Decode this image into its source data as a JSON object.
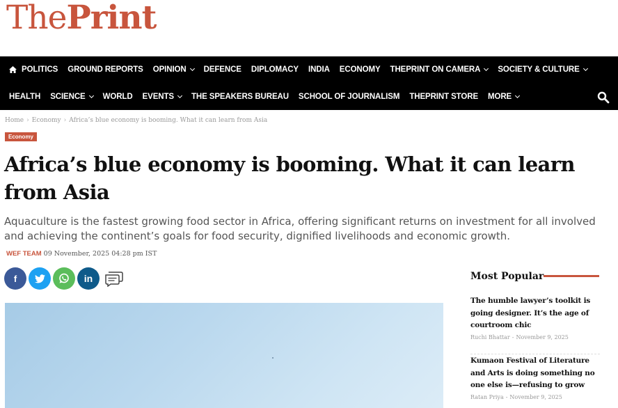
{
  "logo": {
    "the": "The",
    "print": "Print"
  },
  "nav": {
    "row1": [
      {
        "label": "POLITICS",
        "dropdown": false
      },
      {
        "label": "GROUND REPORTS",
        "dropdown": false
      },
      {
        "label": "OPINION",
        "dropdown": true
      },
      {
        "label": "DEFENCE",
        "dropdown": false
      },
      {
        "label": "DIPLOMACY",
        "dropdown": false
      },
      {
        "label": "INDIA",
        "dropdown": false
      },
      {
        "label": "ECONOMY",
        "dropdown": false
      },
      {
        "label": "THEPRINT ON CAMERA",
        "dropdown": true
      },
      {
        "label": "SOCIETY & CULTURE",
        "dropdown": true
      }
    ],
    "row2": [
      {
        "label": "HEALTH",
        "dropdown": false
      },
      {
        "label": "SCIENCE",
        "dropdown": true
      },
      {
        "label": "WORLD",
        "dropdown": false
      },
      {
        "label": "EVENTS",
        "dropdown": true
      },
      {
        "label": "THE SPEAKERS BUREAU",
        "dropdown": false
      },
      {
        "label": "SCHOOL OF JOURNALISM",
        "dropdown": false
      },
      {
        "label": "THEPRINT STORE",
        "dropdown": false
      },
      {
        "label": "MORE",
        "dropdown": true
      }
    ],
    "home_icon": "home-icon",
    "search_icon": "search-icon"
  },
  "breadcrumb": {
    "home": "Home",
    "section": "Economy",
    "current": "Africa’s blue economy is booming. What it can learn from Asia",
    "separator": "›"
  },
  "article": {
    "category": "Economy",
    "headline": "Africa’s blue economy is booming. What it can learn from Asia",
    "standfirst": "Aquaculture is the fastest growing food sector in Africa, offering significant returns on investment for all involved and achieving the continent’s goals for food security, dignified livelihoods and economic growth.",
    "author": "WEF TEAM",
    "date": "09 November, 2025 04:28 pm IST"
  },
  "share": {
    "facebook": "f",
    "twitter_icon": "twitter-icon",
    "whatsapp_icon": "whatsapp-icon",
    "linkedin": "in",
    "comment_icon": "comment-icon"
  },
  "sidebar": {
    "title": "Most Popular",
    "items": [
      {
        "title": "The humble lawyer’s toolkit is going designer. It’s the age of courtroom chic",
        "author": "Ruchi Bhattar",
        "date": "November 9, 2025"
      },
      {
        "title": "Kumaon Festival of Literature and Arts is doing something no one else is—refusing to grow",
        "author": "Ratan Priya",
        "date": "November 9, 2025"
      }
    ],
    "meta_sep": "-"
  },
  "colors": {
    "brand": "#c8553d",
    "nav_bg": "#000000",
    "facebook": "#3b5998",
    "twitter": "#1da1f2",
    "whatsapp": "#5bbd5b",
    "linkedin": "#0e5a8a"
  }
}
